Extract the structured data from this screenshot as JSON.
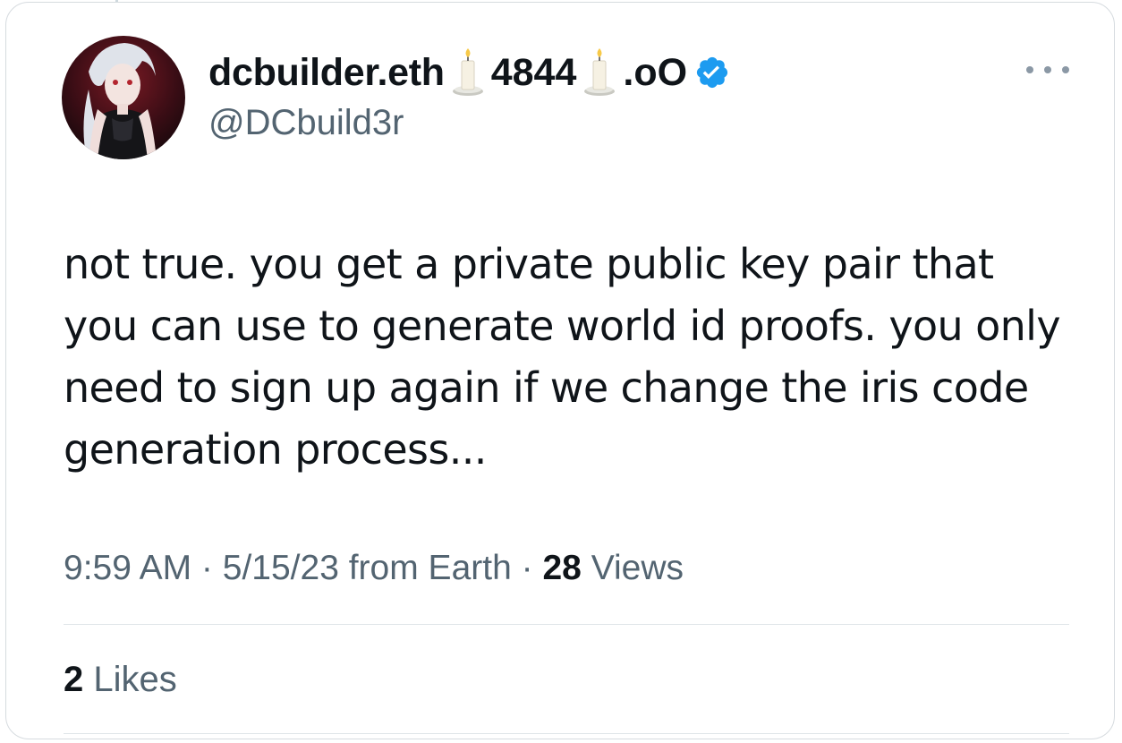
{
  "tweet": {
    "author": {
      "name_parts": [
        "dcbuilder.eth",
        "4844",
        ".oO"
      ],
      "handle": "@DCbuild3r",
      "verified": true,
      "name_emoji": "candle-emoji"
    },
    "text": "not true. you get a private public key pair that you can use to generate world id proofs. you only need to sign up again if we change the iris code generation process...",
    "time": "9:59 AM",
    "separator": " · ",
    "date_source": "5/15/23 from Earth",
    "views_count": "28",
    "views_label": "Views",
    "likes_count": "2",
    "likes_label": "Likes"
  },
  "colors": {
    "verified_badge": "#1d9bf0",
    "secondary_text": "#536471",
    "primary_text": "#0f1419"
  }
}
